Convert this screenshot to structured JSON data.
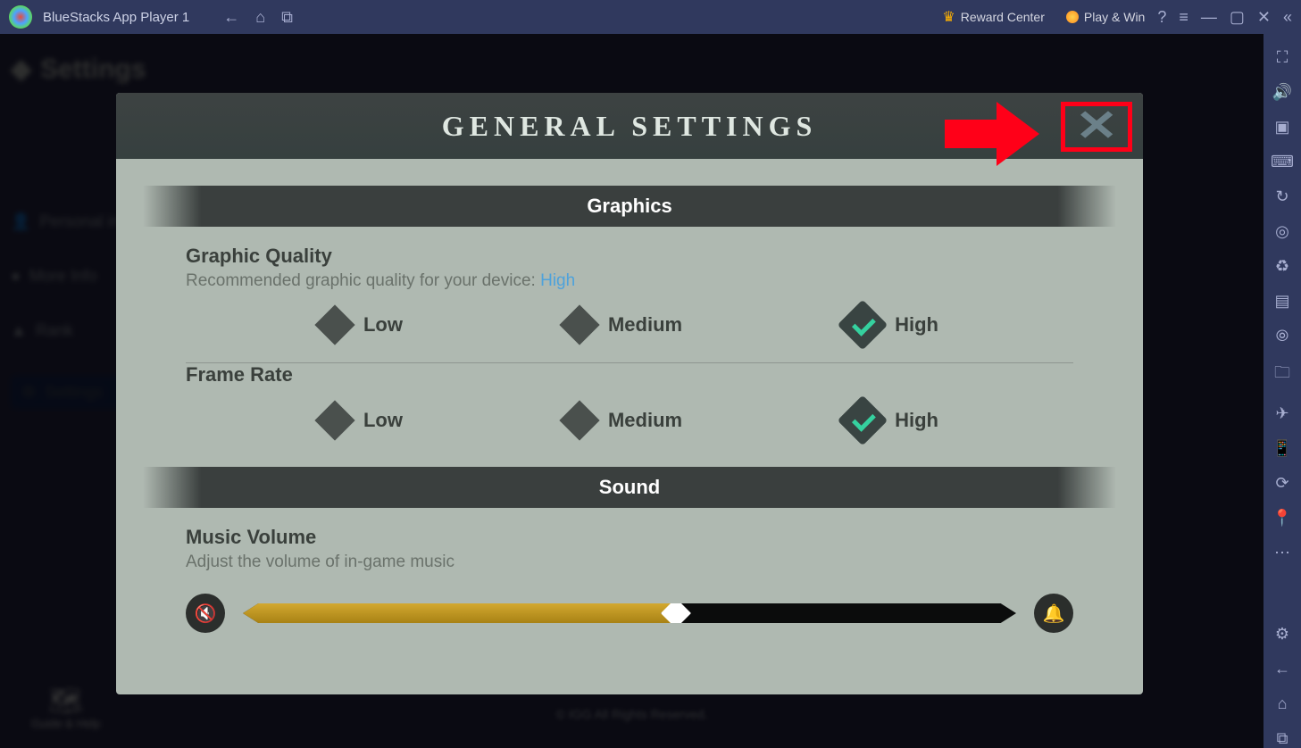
{
  "titlebar": {
    "title": "BlueStacks App Player 1",
    "reward_label": "Reward Center",
    "playwin_label": "Play & Win"
  },
  "background": {
    "settings_title": "Settings",
    "menu": [
      "Personal info",
      "More Info",
      "Rank"
    ],
    "menu_selected": "Settings",
    "copyright": "© IGG All Rights Reserved.",
    "guide": "Guide & Help"
  },
  "modal": {
    "title": "GENERAL SETTINGS",
    "sections": {
      "graphics": {
        "banner": "Graphics",
        "quality_label": "Graphic Quality",
        "quality_sub_prefix": "Recommended graphic quality for your device: ",
        "quality_recommended": "High",
        "framerate_label": "Frame Rate",
        "options": [
          "Low",
          "Medium",
          "High"
        ],
        "quality_selected": "High",
        "framerate_selected": "High"
      },
      "sound": {
        "banner": "Sound",
        "music_label": "Music Volume",
        "music_sub": "Adjust the volume of in-game music",
        "music_percent": 56
      }
    }
  }
}
